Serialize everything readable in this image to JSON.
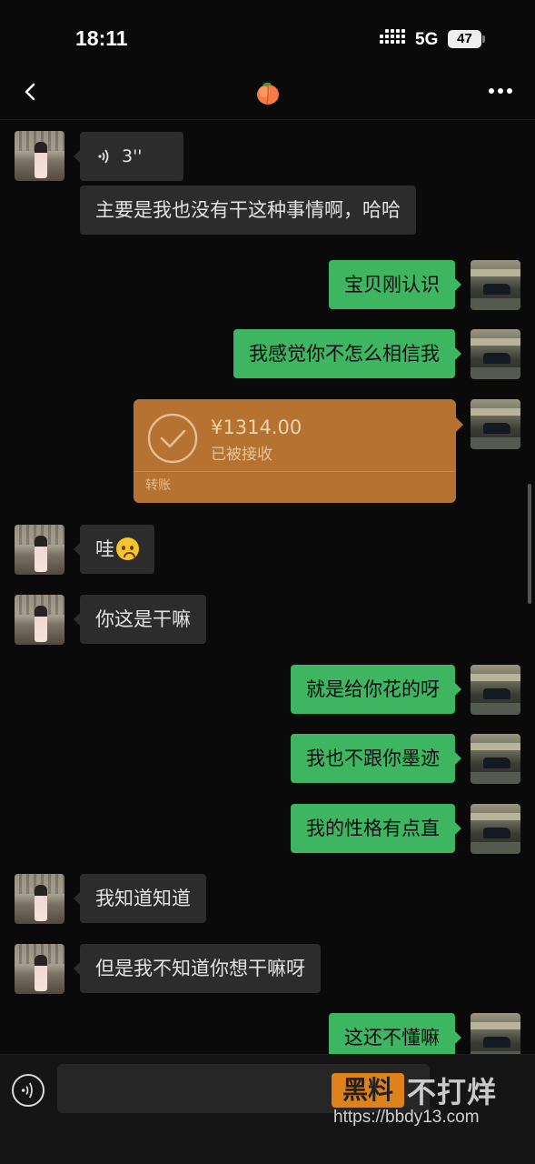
{
  "status_bar": {
    "time": "18:11",
    "network": "5G",
    "battery": "47"
  },
  "header": {
    "contact_icon": "peach-emoji-icon"
  },
  "messages": [
    {
      "side": "in",
      "type": "voice",
      "duration": "3''"
    },
    {
      "side": "in",
      "type": "text",
      "text": "主要是我也没有干这种事情啊，哈哈"
    },
    {
      "side": "out",
      "type": "text",
      "text": "宝贝刚认识"
    },
    {
      "side": "out",
      "type": "text",
      "text": "我感觉你不怎么相信我"
    },
    {
      "side": "out",
      "type": "transfer",
      "amount": "¥1314.00",
      "status": "已被接收",
      "label": "转账"
    },
    {
      "side": "in",
      "type": "text",
      "text": "哇",
      "emoji": "worried-face-emoji"
    },
    {
      "side": "in",
      "type": "text",
      "text": "你这是干嘛"
    },
    {
      "side": "out",
      "type": "text",
      "text": "就是给你花的呀"
    },
    {
      "side": "out",
      "type": "text",
      "text": "我也不跟你墨迹"
    },
    {
      "side": "out",
      "type": "text",
      "text": "我的性格有点直"
    },
    {
      "side": "in",
      "type": "text",
      "text": "我知道知道"
    },
    {
      "side": "in",
      "type": "text",
      "text": "但是我不知道你想干嘛呀"
    },
    {
      "side": "out",
      "type": "text",
      "text": "这还不懂嘛"
    }
  ],
  "input": {
    "placeholder": ""
  },
  "watermark": {
    "badge": "黑料",
    "text": "不打烊",
    "url": "https://bbdy13.com"
  },
  "colors": {
    "background": "#0a0a0a",
    "incoming_bubble": "#2c2c2c",
    "outgoing_bubble": "#3eb561",
    "transfer_card": "#b57230"
  }
}
